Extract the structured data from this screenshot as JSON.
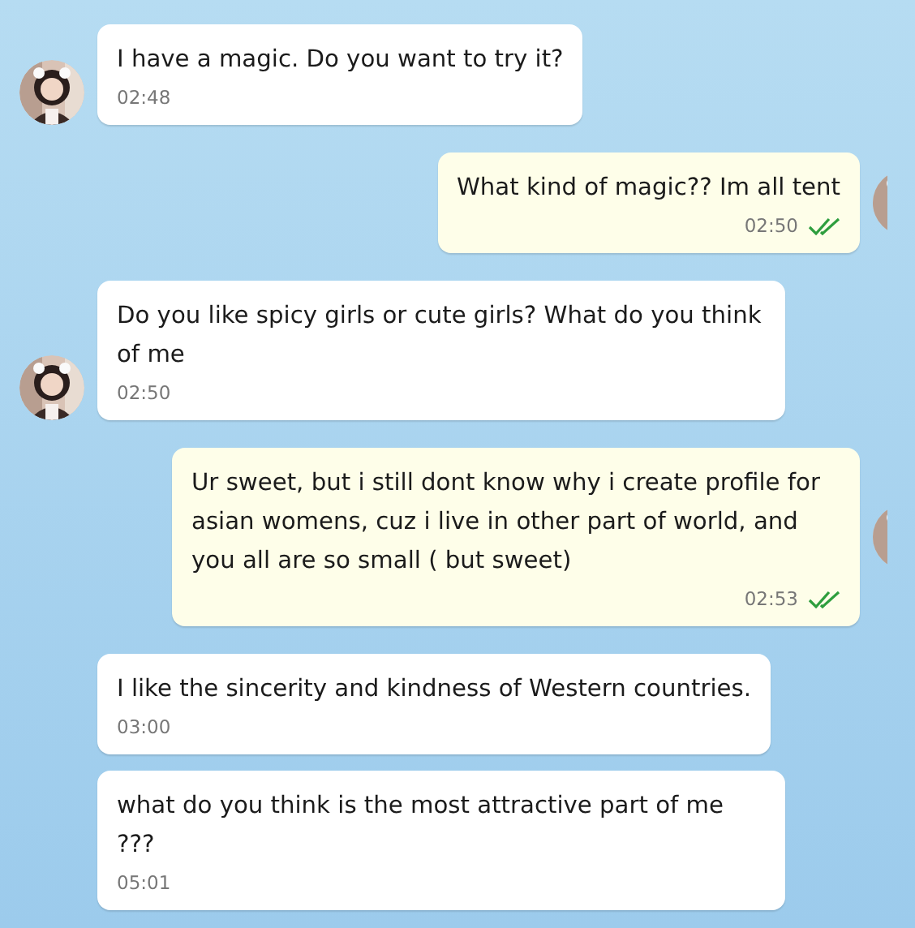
{
  "messages": [
    {
      "kind": "incoming",
      "avatar": true,
      "text": "I have a magic. Do you want to try it?",
      "time": "02:48"
    },
    {
      "kind": "outgoing",
      "avatar": true,
      "text": "What kind of magic?? Im all tent",
      "time": "02:50",
      "read": true
    },
    {
      "kind": "incoming",
      "avatar": true,
      "text": "Do you like spicy girls or cute girls? What do you think of me",
      "time": "02:50"
    },
    {
      "kind": "outgoing",
      "avatar": true,
      "text": "Ur sweet, but i still dont know why i create profile for asian womens, cuz i live in other part of world, and you all are so small ( but sweet)",
      "time": "02:53",
      "read": true
    },
    {
      "kind": "incoming",
      "avatar": false,
      "text": "I like the sincerity and kindness of Western countries.",
      "time": "03:00"
    },
    {
      "kind": "incoming",
      "avatar": false,
      "text": "what do you think is the most attractive part of me ???",
      "time": "05:01"
    }
  ]
}
